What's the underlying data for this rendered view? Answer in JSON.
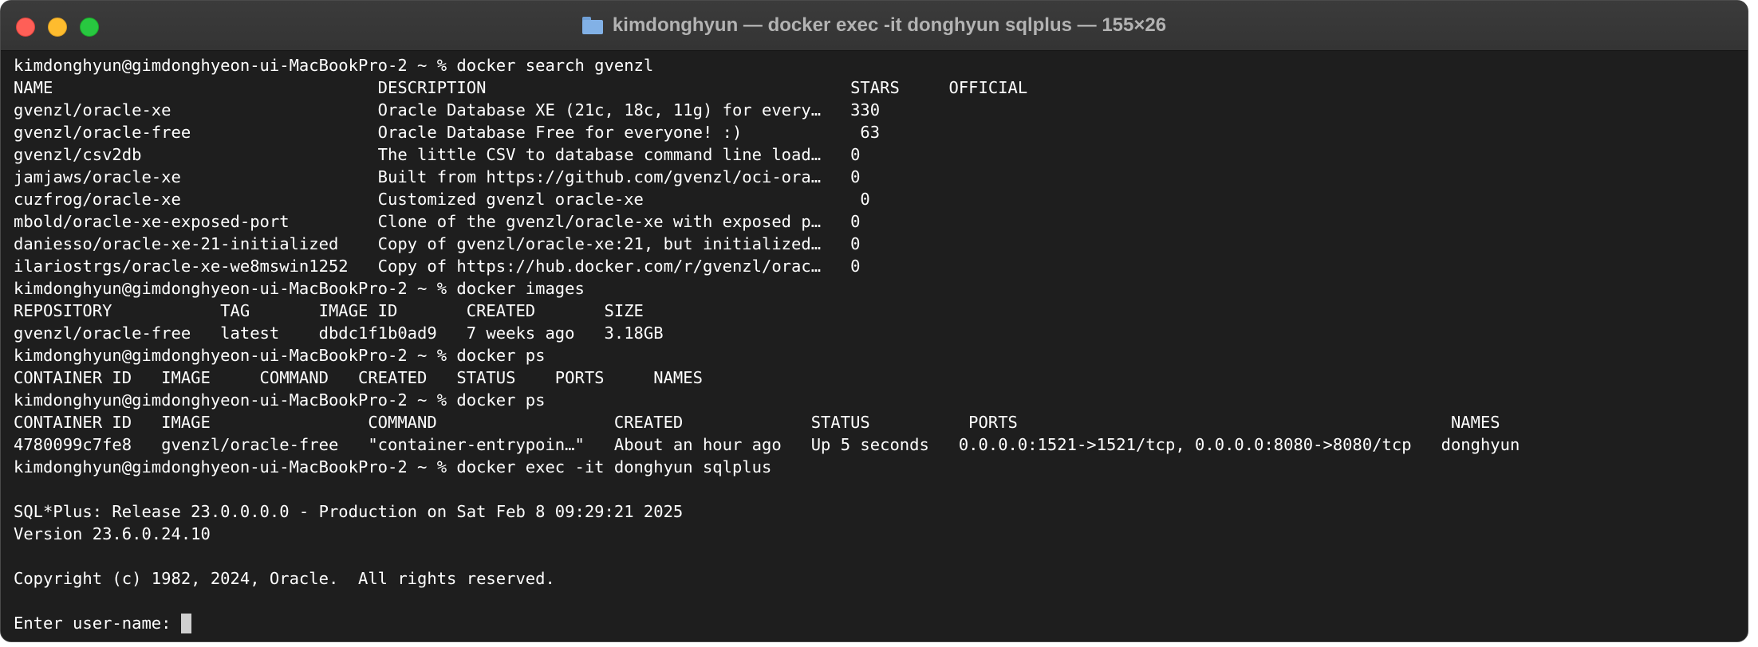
{
  "window": {
    "title": "kimdonghyun — docker exec -it donghyun sqlplus — 155×26",
    "title_icon": "folder-icon",
    "buttons": [
      "close",
      "minimize",
      "zoom"
    ]
  },
  "colors": {
    "background": "#1e1e1e",
    "text": "#ffffff",
    "titlebar": "#383838",
    "title_text": "#b3b3b3",
    "close": "#ff5f57",
    "minimize": "#febc2e",
    "zoom": "#28c840"
  },
  "terminal": {
    "lines": [
      "kimdonghyun@gimdonghyeon-ui-MacBookPro-2 ~ % docker search gvenzl",
      "NAME                                 DESCRIPTION                                     STARS     OFFICIAL",
      "gvenzl/oracle-xe                     Oracle Database XE (21c, 18c, 11g) for every…   330",
      "gvenzl/oracle-free                   Oracle Database Free for everyone! :)            63",
      "gvenzl/csv2db                        The little CSV to database command line load…   0",
      "jamjaws/oracle-xe                    Built from https://github.com/gvenzl/oci-ora…   0",
      "cuzfrog/oracle-xe                    Customized gvenzl oracle-xe                      0",
      "mbold/oracle-xe-exposed-port         Clone of the gvenzl/oracle-xe with exposed p…   0",
      "daniesso/oracle-xe-21-initialized    Copy of gvenzl/oracle-xe:21, but initialized…   0",
      "ilariostrgs/oracle-xe-we8mswin1252   Copy of https://hub.docker.com/r/gvenzl/orac…   0",
      "kimdonghyun@gimdonghyeon-ui-MacBookPro-2 ~ % docker images",
      "REPOSITORY           TAG       IMAGE ID       CREATED       SIZE",
      "gvenzl/oracle-free   latest    dbdc1f1b0ad9   7 weeks ago   3.18GB",
      "kimdonghyun@gimdonghyeon-ui-MacBookPro-2 ~ % docker ps",
      "CONTAINER ID   IMAGE     COMMAND   CREATED   STATUS    PORTS     NAMES",
      "kimdonghyun@gimdonghyeon-ui-MacBookPro-2 ~ % docker ps",
      "CONTAINER ID   IMAGE                COMMAND                  CREATED             STATUS          PORTS                                            NAMES",
      "4780099c7fe8   gvenzl/oracle-free   \"container-entrypoin…\"   About an hour ago   Up 5 seconds   0.0.0.0:1521->1521/tcp, 0.0.0.0:8080->8080/tcp   donghyun",
      "kimdonghyun@gimdonghyeon-ui-MacBookPro-2 ~ % docker exec -it donghyun sqlplus",
      "",
      "SQL*Plus: Release 23.0.0.0.0 - Production on Sat Feb 8 09:29:21 2025",
      "Version 23.6.0.24.10",
      "",
      "Copyright (c) 1982, 2024, Oracle.  All rights reserved.",
      "",
      "Enter user-name: "
    ]
  }
}
